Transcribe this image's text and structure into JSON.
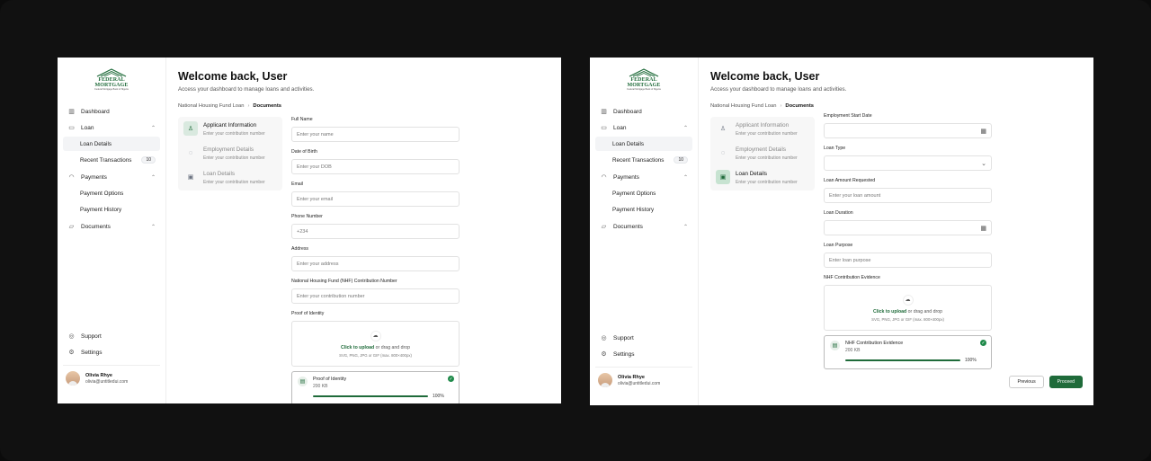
{
  "brand": {
    "name_line1": "FEDERAL",
    "name_line2": "MORTGAGE",
    "tagline": "Federal Mortgage Bank of Nigeria"
  },
  "nav": {
    "dashboard": "Dashboard",
    "loan": "Loan",
    "loan_details": "Loan Details",
    "recent_transactions": "Recent Transactions",
    "recent_transactions_count": "10",
    "payments": "Payments",
    "payment_options": "Payment Options",
    "payment_history": "Payment History",
    "documents": "Documents",
    "support": "Support",
    "settings": "Settings"
  },
  "user": {
    "name": "Olivia Rhye",
    "email": "olivia@untitledui.com"
  },
  "header": {
    "title": "Welcome back, User",
    "subtitle": "Access your dashboard to manage loans and activities."
  },
  "breadcrumb": {
    "parent": "National Housing Fund Loan",
    "current": "Documents"
  },
  "steps": [
    {
      "title": "Applicant Information",
      "desc": "Enter your contribution number"
    },
    {
      "title": "Employment Details",
      "desc": "Enter your contribution number"
    },
    {
      "title": "Loan Details",
      "desc": "Enter your contribution number"
    }
  ],
  "form_a": {
    "full_name_label": "Full Name",
    "full_name_ph": "Enter your name",
    "dob_label": "Date of Birth",
    "dob_ph": "Enter your DOB",
    "email_label": "Email",
    "email_ph": "Enter your email",
    "phone_label": "Phone Number",
    "phone_value": "+234",
    "address_label": "Address",
    "address_ph": "Enter your address",
    "nhf_label": "National Housing Fund (NHF) Contribution Number",
    "nhf_ph": "Enter your contribution number",
    "poi_label": "Proof of Identity",
    "upload_link": "Click to upload",
    "upload_text": "or drag and drop",
    "upload_hint": "SVG, PNG, JPG or GIF (max. 800×400px)",
    "file_name": "Proof of Identity",
    "file_size": "200 KB",
    "file_progress": 1.0,
    "file_pct": "100%"
  },
  "form_b": {
    "start_label": "Employment Start Date",
    "loan_type_label": "Loan Type",
    "amount_label": "Loan Amount Requested",
    "amount_ph": "Enter your loan amount",
    "duration_label": "Loan Duration",
    "purpose_label": "Loan Purpose",
    "purpose_ph": "Enter loan purpose",
    "evidence_label": "NHF Contribution Evidence",
    "upload_link": "Click to upload",
    "upload_text": "or drag and drop",
    "upload_hint": "SVG, PNG, JPG or GIF (max. 800×400px)",
    "file_name": "NHF Contribution Evidence",
    "file_size": "200 KB",
    "file_progress": 1.0,
    "file_pct": "100%"
  },
  "buttons": {
    "previous": "Previous",
    "proceed": "Proceed"
  },
  "colors": {
    "brand": "#1f6b3a"
  }
}
